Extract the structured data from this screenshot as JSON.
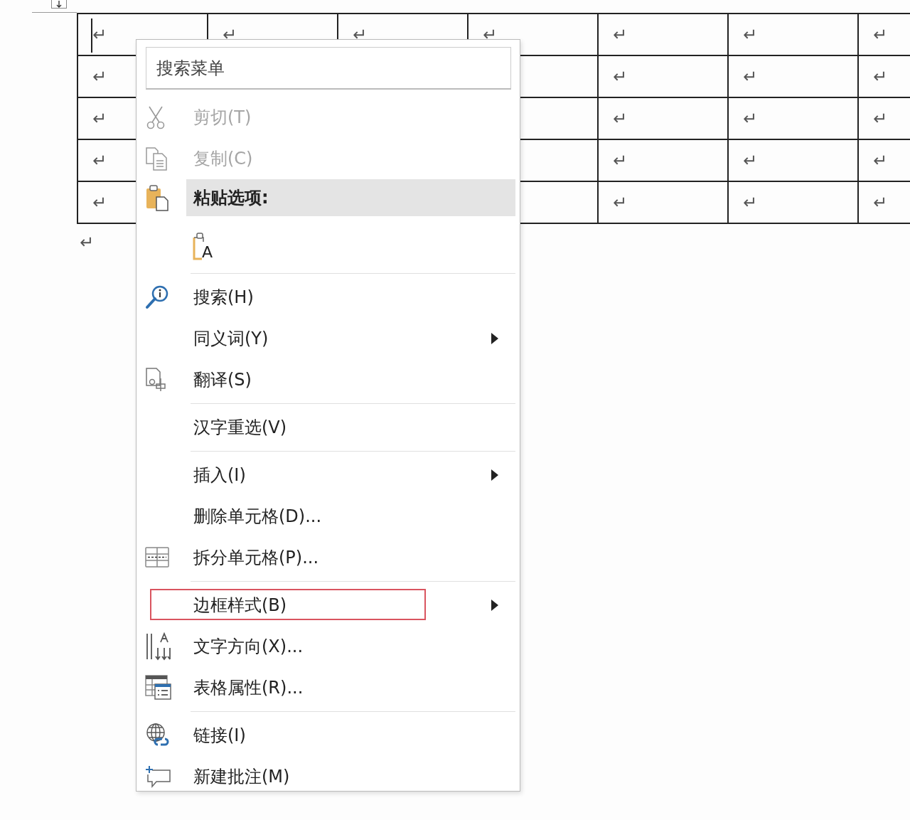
{
  "table": {
    "cursor_in_first_cell": true,
    "rows": [
      {
        "cells": [
          "↵",
          "↵",
          "↵",
          "↵",
          "↵",
          "↵",
          "↵"
        ]
      },
      {
        "cells": [
          "↵",
          null,
          null,
          null,
          "↵",
          "↵",
          "↵"
        ]
      },
      {
        "cells": [
          "↵",
          null,
          null,
          null,
          "↵",
          "↵",
          "↵"
        ]
      },
      {
        "cells": [
          "↵",
          null,
          null,
          null,
          "↵",
          "↵",
          "↵"
        ]
      },
      {
        "cells": [
          "↵",
          null,
          null,
          null,
          "↵",
          "↵",
          "↵"
        ]
      }
    ]
  },
  "paragraph_mark": "↵",
  "context_menu": {
    "search": {
      "placeholder": "搜索菜单"
    },
    "items": [
      {
        "kind": "command",
        "label": "剪切(T)",
        "disabled": true,
        "selected": false,
        "submenu": false,
        "outlined": false
      },
      {
        "kind": "command",
        "label": "复制(C)",
        "disabled": true,
        "selected": false,
        "submenu": false,
        "outlined": false
      },
      {
        "kind": "header",
        "label": "粘贴选项:",
        "selected": true
      },
      {
        "kind": "paste_button",
        "label": "A"
      },
      {
        "kind": "separator"
      },
      {
        "kind": "command",
        "label": "搜索(H)",
        "disabled": false,
        "selected": false,
        "submenu": false,
        "outlined": false
      },
      {
        "kind": "command",
        "label": "同义词(Y)",
        "disabled": false,
        "selected": false,
        "submenu": true,
        "outlined": false
      },
      {
        "kind": "command",
        "label": "翻译(S)",
        "disabled": false,
        "selected": false,
        "submenu": false,
        "outlined": false
      },
      {
        "kind": "separator"
      },
      {
        "kind": "command",
        "label": "汉字重选(V)",
        "disabled": false,
        "selected": false,
        "submenu": false,
        "outlined": false
      },
      {
        "kind": "separator"
      },
      {
        "kind": "command",
        "label": "插入(I)",
        "disabled": false,
        "selected": false,
        "submenu": true,
        "outlined": false
      },
      {
        "kind": "command",
        "label": "删除单元格(D)...",
        "disabled": false,
        "selected": false,
        "submenu": false,
        "outlined": false
      },
      {
        "kind": "command",
        "label": "拆分单元格(P)...",
        "disabled": false,
        "selected": false,
        "submenu": false,
        "outlined": false
      },
      {
        "kind": "separator"
      },
      {
        "kind": "command",
        "label": "边框样式(B)",
        "disabled": false,
        "selected": false,
        "submenu": true,
        "outlined": true
      },
      {
        "kind": "command",
        "label": "文字方向(X)...",
        "disabled": false,
        "selected": false,
        "submenu": false,
        "outlined": false
      },
      {
        "kind": "command",
        "label": "表格属性(R)...",
        "disabled": false,
        "selected": false,
        "submenu": false,
        "outlined": false
      },
      {
        "kind": "separator"
      },
      {
        "kind": "command",
        "label": "链接(I)",
        "disabled": false,
        "selected": false,
        "submenu": false,
        "outlined": false
      },
      {
        "kind": "command",
        "label": "新建批注(M)",
        "disabled": false,
        "selected": false,
        "submenu": false,
        "outlined": false
      }
    ]
  }
}
